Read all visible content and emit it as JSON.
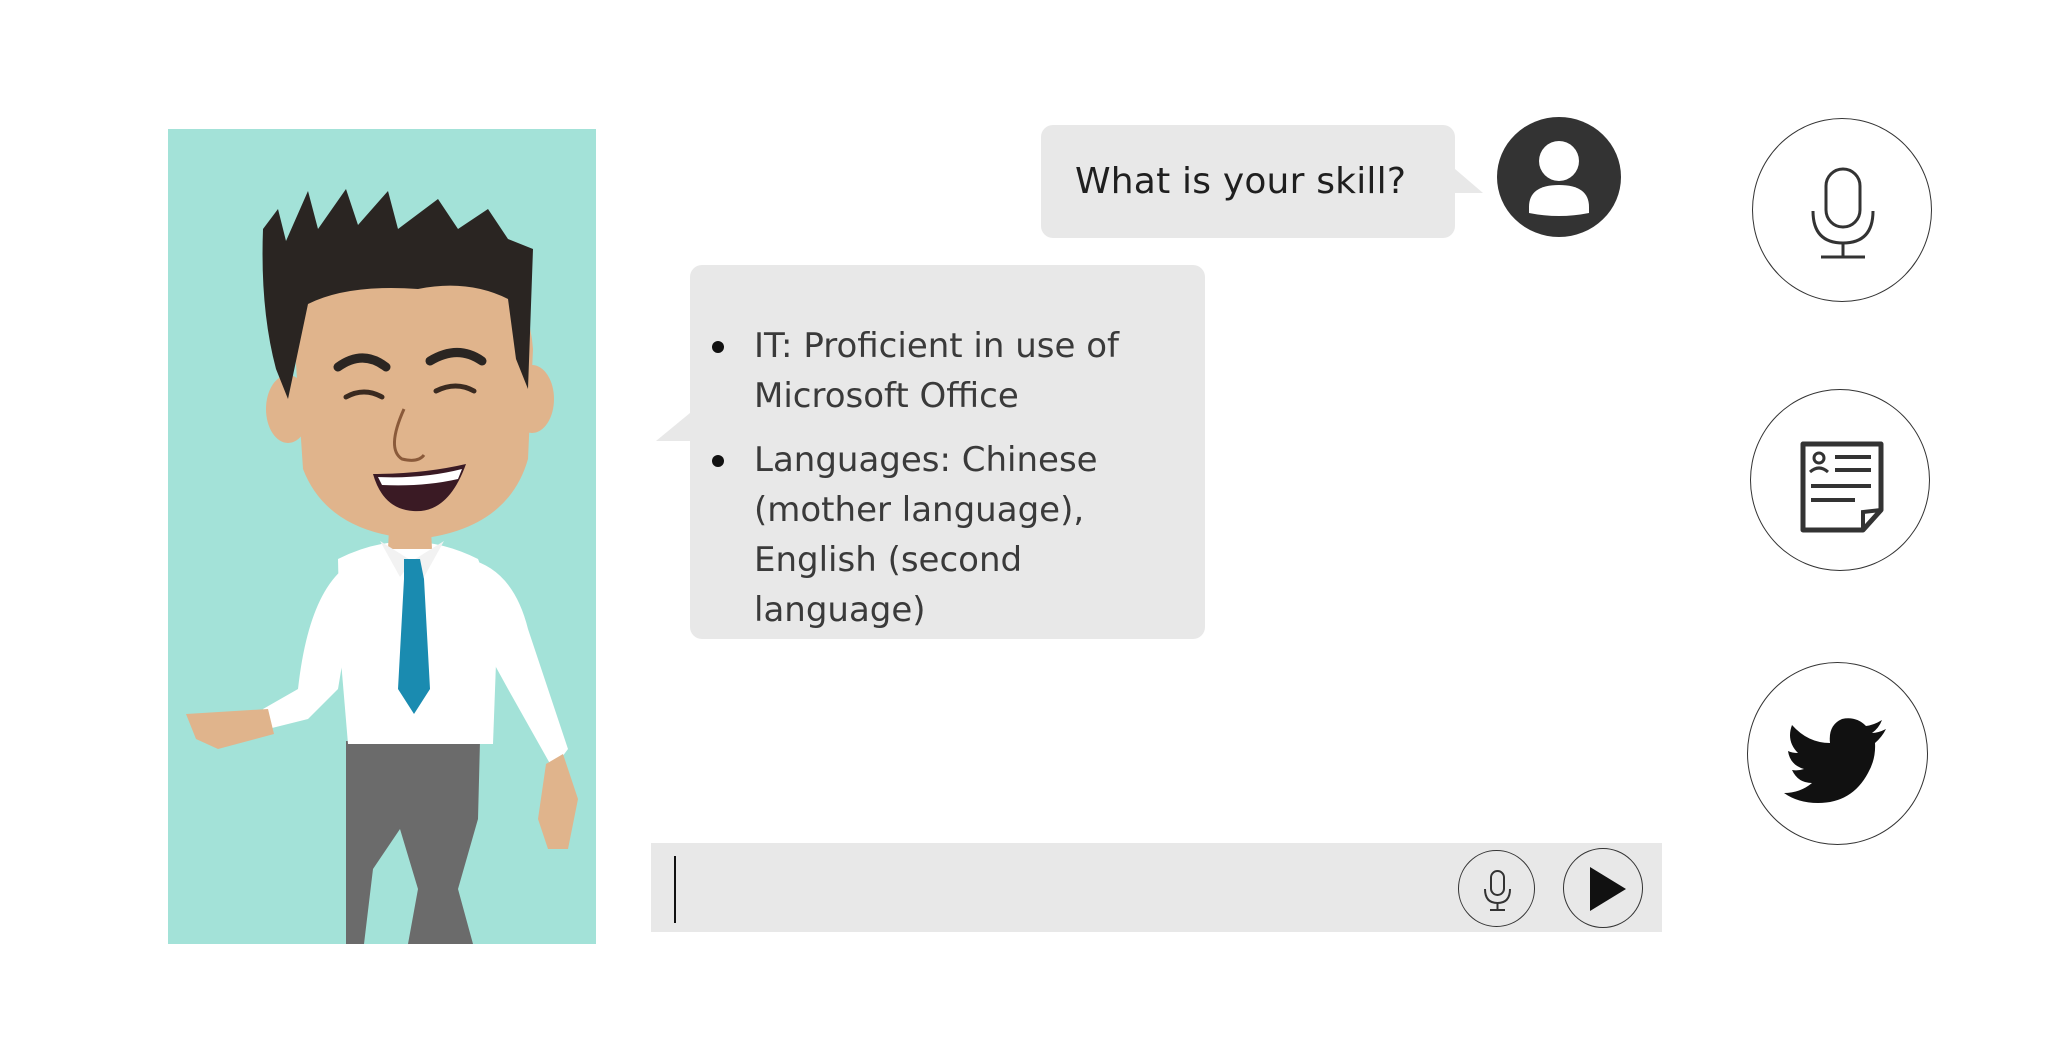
{
  "avatar": {
    "background_color": "#a3e2d8",
    "figure": "cartoon-man-white-shirt-blue-tie"
  },
  "chat": {
    "user_message": {
      "text": "What is your skill?",
      "avatar_icon": "user-icon"
    },
    "bot_message": {
      "items": [
        "IT: Proficient in use of Microsoft Office",
        "Languages: Chinese (mother language), English (second language)"
      ]
    }
  },
  "input_bar": {
    "value": "",
    "placeholder": "",
    "mic_icon": "microphone-icon",
    "send_icon": "play-send-icon"
  },
  "side_buttons": [
    {
      "icon": "microphone-icon"
    },
    {
      "icon": "resume-document-icon"
    },
    {
      "icon": "twitter-bird-icon"
    }
  ],
  "colors": {
    "bubble": "#e8e8e8",
    "text_dark": "#1f1f1f",
    "text_muted": "#3a3a3a",
    "avatar_dark": "#333333"
  }
}
